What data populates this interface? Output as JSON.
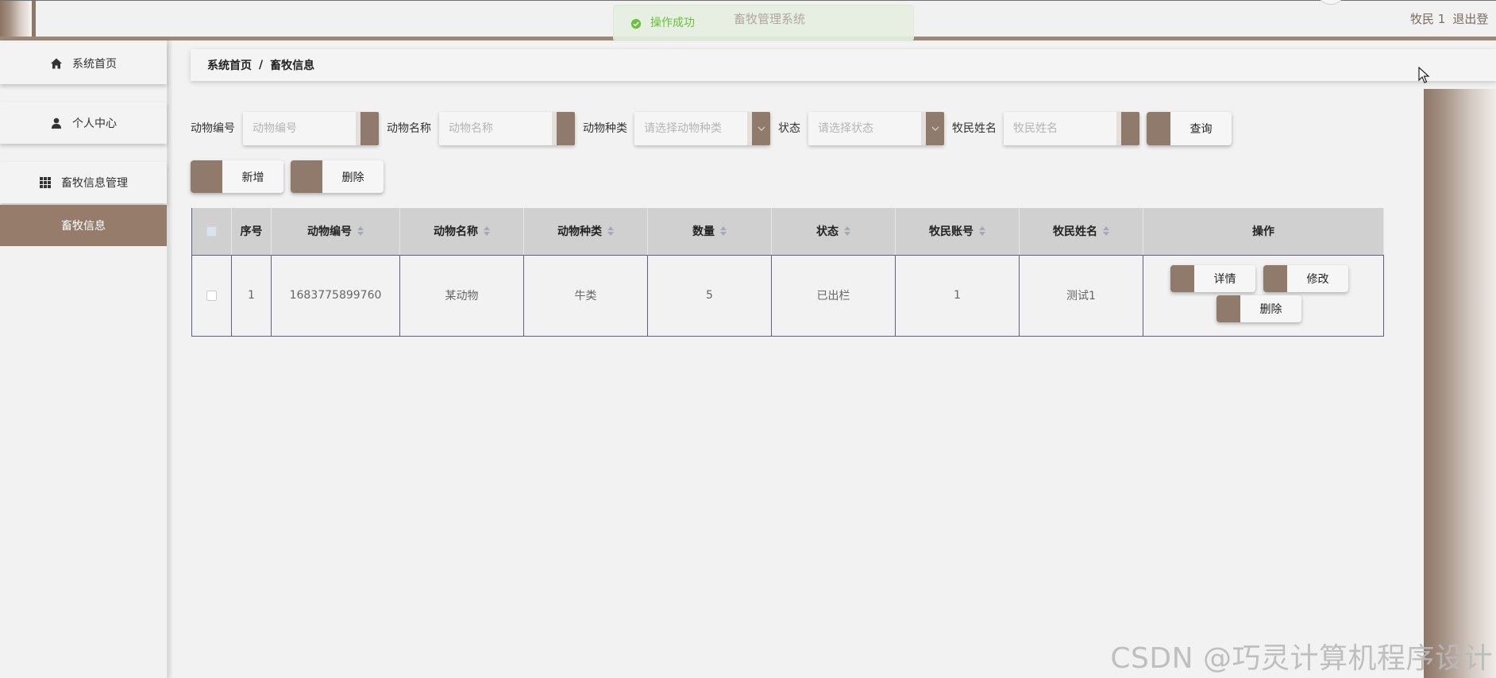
{
  "app": {
    "title": "畜牧管理系统",
    "user": "牧民 1",
    "logout": "退出登"
  },
  "toast": {
    "message": "操作成功",
    "icon": "success-check-icon"
  },
  "sidebar": {
    "items": [
      {
        "label": "系统首页",
        "icon": "home-icon"
      },
      {
        "label": "个人中心",
        "icon": "user-icon"
      },
      {
        "label": "畜牧信息管理",
        "icon": "grid-icon"
      }
    ],
    "subitems": [
      {
        "label": "畜牧信息",
        "active": true
      }
    ]
  },
  "breadcrumb": {
    "items": [
      "系统首页",
      "畜牧信息"
    ],
    "separator": "/"
  },
  "search": {
    "fields": [
      {
        "label": "动物编号",
        "placeholder": "动物编号"
      },
      {
        "label": "动物名称",
        "placeholder": "动物名称"
      },
      {
        "label": "动物种类",
        "placeholder": "请选择动物种类"
      },
      {
        "label": "状态",
        "placeholder": "请选择状态"
      },
      {
        "label": "牧民姓名",
        "placeholder": "牧民姓名"
      }
    ],
    "query_label": "查询"
  },
  "toolbar": {
    "add_label": "新增",
    "delete_label": "删除"
  },
  "table": {
    "columns": [
      {
        "label": "序号",
        "sortable": false
      },
      {
        "label": "动物编号",
        "sortable": true
      },
      {
        "label": "动物名称",
        "sortable": true
      },
      {
        "label": "动物种类",
        "sortable": true
      },
      {
        "label": "数量",
        "sortable": true
      },
      {
        "label": "状态",
        "sortable": true
      },
      {
        "label": "牧民账号",
        "sortable": true
      },
      {
        "label": "牧民姓名",
        "sortable": true
      },
      {
        "label": "操作",
        "sortable": false
      }
    ],
    "rows": [
      {
        "index": "1",
        "animal_id": "1683775899760",
        "animal_name": "某动物",
        "animal_type": "牛类",
        "quantity": "5",
        "status": "已出栏",
        "herder_account": "1",
        "herder_name": "测试1"
      }
    ],
    "row_actions": {
      "detail": "详情",
      "edit": "修改",
      "delete": "删除"
    }
  },
  "watermark": "CSDN @巧灵计算机程序设计",
  "colors": {
    "brand_brown": "#8f7a6b",
    "sidebar_active": "#957c6b",
    "success_green": "#67c23a",
    "table_border": "#5f5e86",
    "table_header_bg": "#d0d0d0",
    "page_bg": "#f2f2f2"
  }
}
